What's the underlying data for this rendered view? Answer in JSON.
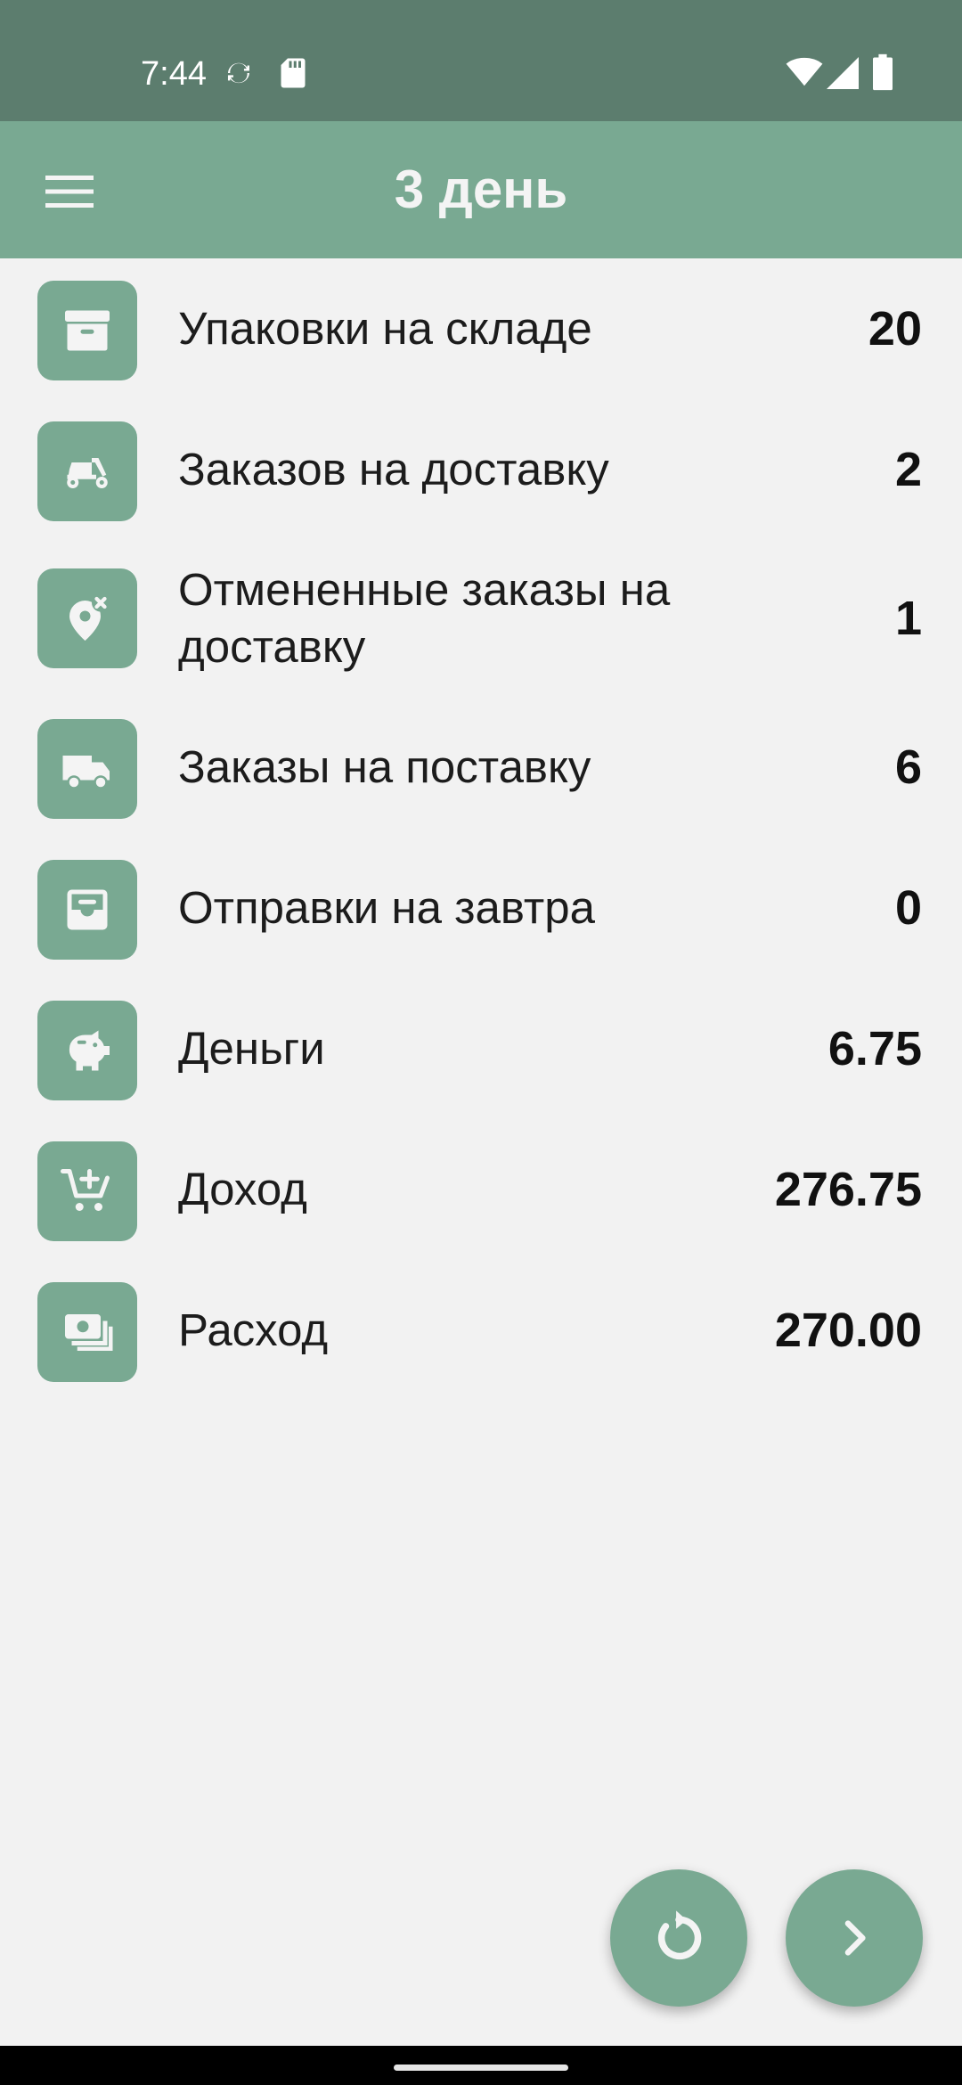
{
  "status_bar": {
    "time": "7:44",
    "icons": [
      "sync-icon",
      "sd-card-icon",
      "wifi-icon",
      "signal-icon",
      "battery-icon"
    ]
  },
  "app_bar": {
    "title": "3 день",
    "menu_icon": "hamburger-menu-icon"
  },
  "stats": [
    {
      "icon": "archive-box-icon",
      "label": "Упаковки на складе",
      "value": "20"
    },
    {
      "icon": "delivery-scooter-icon",
      "label": "Заказов на доставку",
      "value": "2"
    },
    {
      "icon": "cancelled-location-icon",
      "label": "Отмененные заказы на доставку",
      "value": "1"
    },
    {
      "icon": "delivery-truck-icon",
      "label": "Заказы на поставку",
      "value": "6"
    },
    {
      "icon": "inbox-tray-icon",
      "label": "Отправки на завтра",
      "value": "0"
    },
    {
      "icon": "piggy-bank-icon",
      "label": "Деньги",
      "value": "6.75"
    },
    {
      "icon": "add-to-cart-icon",
      "label": "Доход",
      "value": "276.75"
    },
    {
      "icon": "money-bills-icon",
      "label": "Расход",
      "value": "270.00"
    }
  ],
  "actions": {
    "restart_icon": "restart-icon",
    "next_icon": "chevron-right-icon"
  },
  "colors": {
    "status_bar": "#5c7d6e",
    "accent": "#79a992",
    "background": "#f2f2f2",
    "text": "#1c1c1c"
  }
}
